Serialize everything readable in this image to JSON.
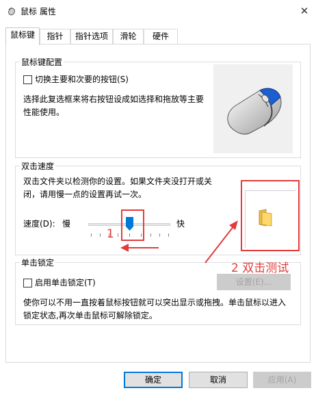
{
  "window": {
    "title": "鼠标 属性",
    "close_symbol": "✕"
  },
  "tabs": [
    {
      "label": "鼠标键",
      "active": true
    },
    {
      "label": "指针",
      "active": false
    },
    {
      "label": "指针选项",
      "active": false
    },
    {
      "label": "滑轮",
      "active": false
    },
    {
      "label": "硬件",
      "active": false
    }
  ],
  "button_config": {
    "group_title": "鼠标键配置",
    "swap_checkbox_label": "切换主要和次要的按钮(S)",
    "swap_checked": false,
    "description": "选择此复选框来将右按钮设成如选择和拖放等主要性能使用。"
  },
  "double_click": {
    "group_title": "双击速度",
    "description": "双击文件夹以检测你的设置。如果文件夹没打开或关闭，请用慢一点的设置再试一次。",
    "speed_label": "速度(D):",
    "slow_label": "慢",
    "fast_label": "快",
    "speed_value_fraction": 0.45
  },
  "click_lock": {
    "group_title": "单击锁定",
    "checkbox_label": "启用单击锁定(T)",
    "checked": false,
    "settings_button": "设置(E)...",
    "description": "使你可以不用一直按着鼠标按钮就可以突出显示或拖拽。单击鼠标以进入锁定状态,再次单击鼠标可解除锁定。"
  },
  "footer": {
    "ok": "确定",
    "cancel": "取消",
    "apply": "应用(A)"
  },
  "annotations": {
    "one": "1",
    "two": "2 双击测试",
    "color": "#e23b3b"
  },
  "icons": {
    "title": "mouse-icon",
    "preview": "mouse-illustration",
    "test": "folder-icon"
  }
}
